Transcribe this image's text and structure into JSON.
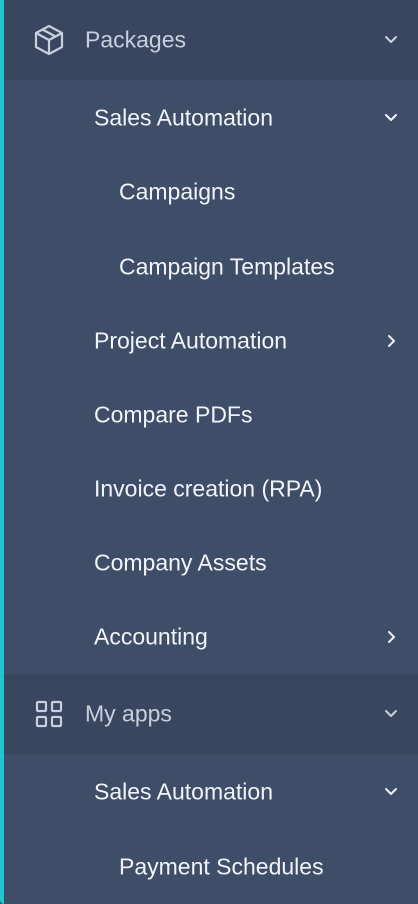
{
  "accent_color": "#1ec8cf",
  "packages": {
    "label": "Packages",
    "icon": "box-icon",
    "expanded": true,
    "items": [
      {
        "label": "Sales Automation",
        "chevron": "down"
      },
      {
        "label": "Campaigns"
      },
      {
        "label": "Campaign Templates"
      },
      {
        "label": "Project Automation",
        "chevron": "right"
      },
      {
        "label": "Compare PDFs"
      },
      {
        "label": "Invoice creation (RPA)"
      },
      {
        "label": "Company Assets"
      },
      {
        "label": "Accounting",
        "chevron": "right"
      }
    ]
  },
  "my_apps": {
    "label": "My apps",
    "icon": "grid-icon",
    "expanded": true,
    "items": [
      {
        "label": "Sales Automation",
        "chevron": "down"
      },
      {
        "label": "Payment Schedules"
      }
    ]
  }
}
